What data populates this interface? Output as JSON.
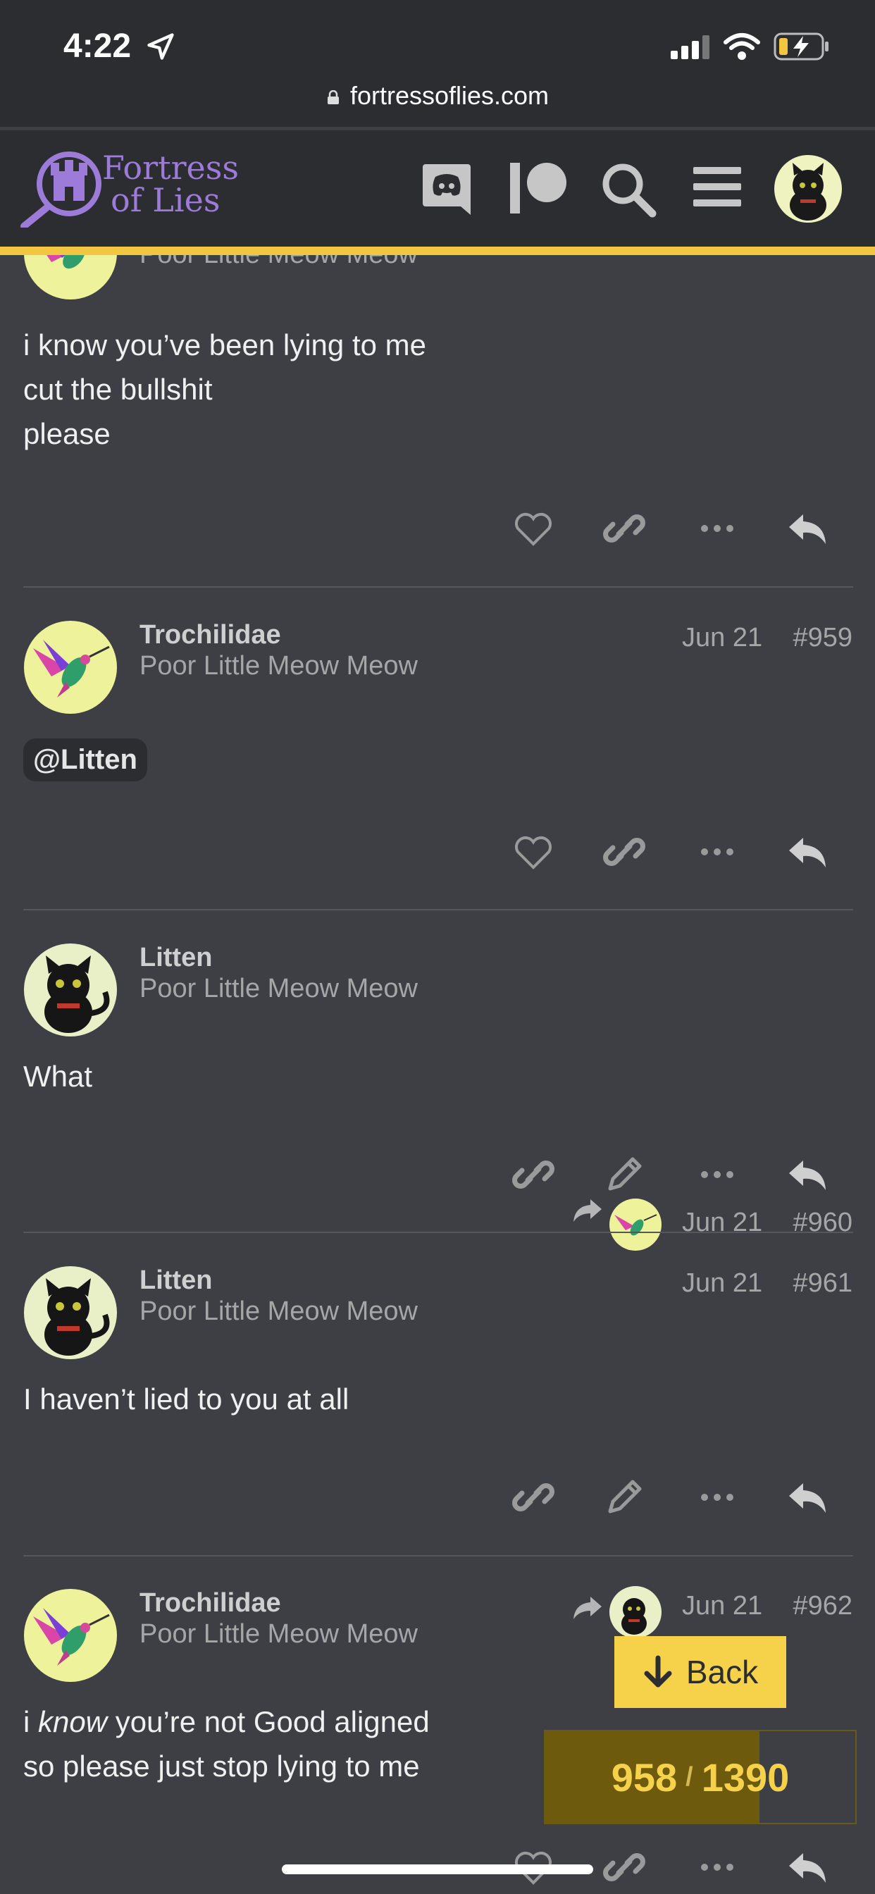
{
  "status_bar": {
    "time": "4:22",
    "url": "fortressoflies.com"
  },
  "header": {
    "logo_line1": "Fortress",
    "logo_line2": "of Lies"
  },
  "posts": [
    {
      "username": "",
      "user_title": "Poor Little Meow Meow",
      "text_lines": [
        "i know you’ve been lying to me",
        "cut the bullshit",
        "please"
      ]
    },
    {
      "username": "Trochilidae",
      "user_title": "Poor Little Meow Meow",
      "date": "Jun 21",
      "number": "#959",
      "mention": "@Litten"
    },
    {
      "username": "Litten",
      "user_title": "Poor Little Meow Meow",
      "date": "Jun 21",
      "number": "#960",
      "text": "What"
    },
    {
      "username": "Litten",
      "user_title": "Poor Little Meow Meow",
      "date": "Jun 21",
      "number": "#961",
      "text": "I haven’t lied to you at all"
    },
    {
      "username": "Trochilidae",
      "user_title": "Poor Little Meow Meow",
      "date": "Jun 21",
      "number": "#962",
      "text_line1_pre": "i ",
      "text_line1_em": "know",
      "text_line1_post": " you’re not Good aligned",
      "text_line2": "so please just stop lying to me"
    }
  ],
  "timeline": {
    "back_label": "Back",
    "current": "958",
    "total": "1390",
    "progress_fraction": 0.69
  },
  "colors": {
    "accent": "#f2c640",
    "background": "#3d3f44",
    "header_bg": "#2c2d31",
    "logo_purple": "#9c7bd9"
  }
}
